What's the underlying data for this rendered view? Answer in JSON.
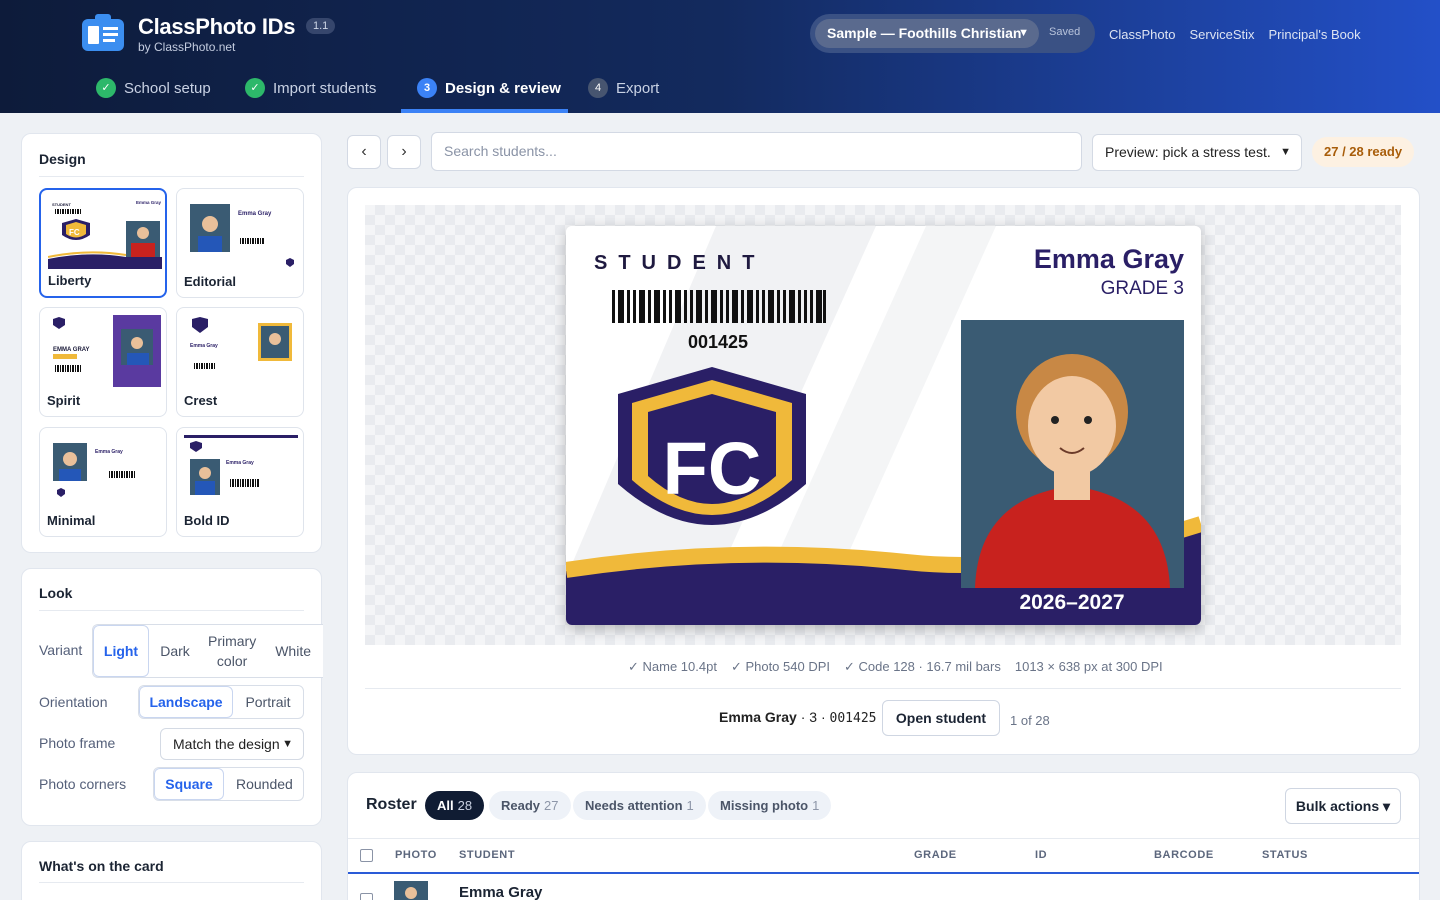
{
  "app": {
    "title": "ClassPhoto IDs",
    "version": "1.1",
    "byline": "by ClassPhoto.net"
  },
  "header": {
    "sample_label": "Sample — Foothills Christian",
    "saved_label": "Saved",
    "links": [
      "ClassPhoto",
      "ServiceStix",
      "Principal's Book"
    ]
  },
  "steps": [
    {
      "num": "✓",
      "label": "School setup",
      "state": "done"
    },
    {
      "num": "✓",
      "label": "Import students",
      "state": "done"
    },
    {
      "num": "3",
      "label": "Design & review",
      "state": "current"
    },
    {
      "num": "4",
      "label": "Export",
      "state": "todo"
    }
  ],
  "design": {
    "title": "Design",
    "templates": [
      "Liberty",
      "Editorial",
      "Spirit",
      "Crest",
      "Minimal",
      "Bold ID"
    ],
    "selected": "Liberty"
  },
  "look": {
    "title": "Look",
    "variant_label": "Variant",
    "variants": [
      "Light",
      "Dark",
      "Primary color",
      "White"
    ],
    "variant_selected": "Light",
    "orientation_label": "Orientation",
    "orientations": [
      "Landscape",
      "Portrait"
    ],
    "orientation_selected": "Landscape",
    "frame_label": "Photo frame",
    "frame_value": "Match the design",
    "corners_label": "Photo corners",
    "corners": [
      "Square",
      "Rounded"
    ],
    "corners_selected": "Square"
  },
  "wotc": {
    "title": "What's on the card"
  },
  "toolbar": {
    "prev": "‹",
    "next": "›",
    "search_placeholder": "Search students...",
    "preview_select": "Preview: pick a stress test.",
    "ready_badge": "27 / 28 ready"
  },
  "card": {
    "role": "STUDENT",
    "id": "001425",
    "school_initials": "FC",
    "name": "Emma Gray",
    "grade": "GRADE 3",
    "year": "2026–2027"
  },
  "metrics": [
    "✓ Name 10.4pt",
    "✓ Photo 540 DPI",
    "✓ Code 128 · 16.7 mil bars",
    "1013 × 638 px at 300 DPI"
  ],
  "current": {
    "name": "Emma Gray",
    "grade": "3",
    "id": "001425",
    "open_label": "Open student",
    "position": "1 of 28"
  },
  "roster": {
    "title": "Roster",
    "filters": [
      {
        "label": "All",
        "count": "28"
      },
      {
        "label": "Ready",
        "count": "27"
      },
      {
        "label": "Needs attention",
        "count": "1"
      },
      {
        "label": "Missing photo",
        "count": "1"
      }
    ],
    "bulk_label": "Bulk actions ▾",
    "columns": [
      "PHOTO",
      "STUDENT",
      "GRADE",
      "ID",
      "BARCODE",
      "STATUS"
    ],
    "rows": [
      {
        "student": "Emma Gray"
      }
    ]
  },
  "colors": {
    "accent": "#2563eb",
    "navy": "#2a1f66",
    "gold": "#f0b93a",
    "header_dark": "#0d1b3a"
  }
}
